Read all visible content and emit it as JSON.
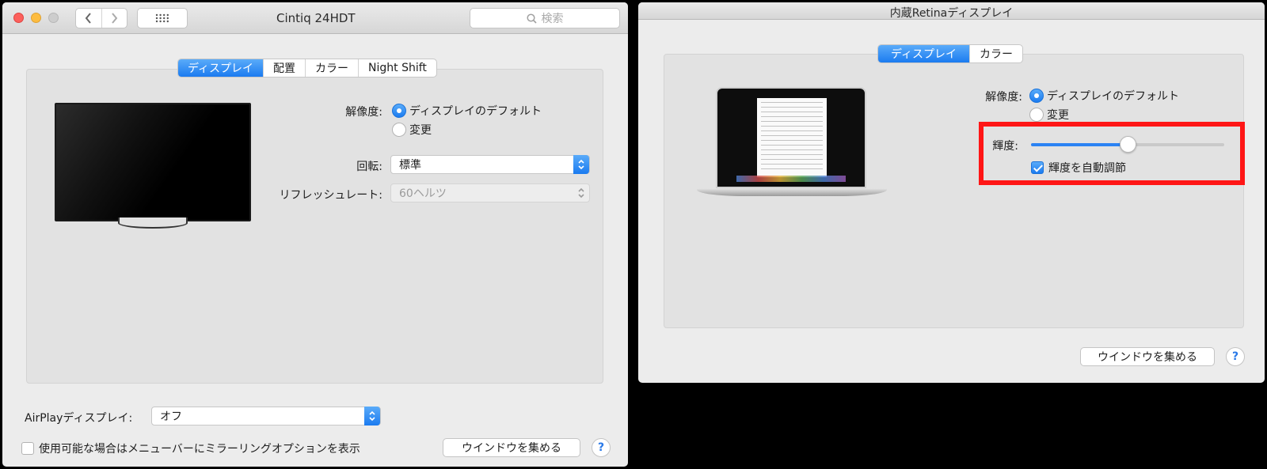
{
  "left_window": {
    "title": "Cintiq 24HDT",
    "search_placeholder": "検索",
    "tabs": [
      "ディスプレイ",
      "配置",
      "カラー",
      "Night Shift"
    ],
    "active_tab": 0,
    "resolution": {
      "label": "解像度:",
      "options": [
        "ディスプレイのデフォルト",
        "変更"
      ],
      "selected": 0
    },
    "rotation": {
      "label": "回転:",
      "value": "標準"
    },
    "refresh": {
      "label": "リフレッシュレート:",
      "value": "60ヘルツ",
      "enabled": false
    },
    "airplay": {
      "label": "AirPlayディスプレイ:",
      "value": "オフ"
    },
    "mirror_option": {
      "label": "使用可能な場合はメニューバーにミラーリングオプションを表示",
      "checked": false
    },
    "gather_button": "ウインドウを集める",
    "help": "?"
  },
  "right_window": {
    "title": "内蔵Retinaディスプレイ",
    "tabs": [
      "ディスプレイ",
      "カラー"
    ],
    "active_tab": 0,
    "resolution": {
      "label": "解像度:",
      "options": [
        "ディスプレイのデフォルト",
        "変更"
      ],
      "selected": 0
    },
    "brightness": {
      "label": "輝度:",
      "level": 0.5
    },
    "auto_brightness": {
      "label": "輝度を自動調節",
      "checked": true
    },
    "gather_button": "ウインドウを集める",
    "help": "?"
  },
  "colors": {
    "accent": "#1b7bf0",
    "highlight": "#ff1616"
  }
}
